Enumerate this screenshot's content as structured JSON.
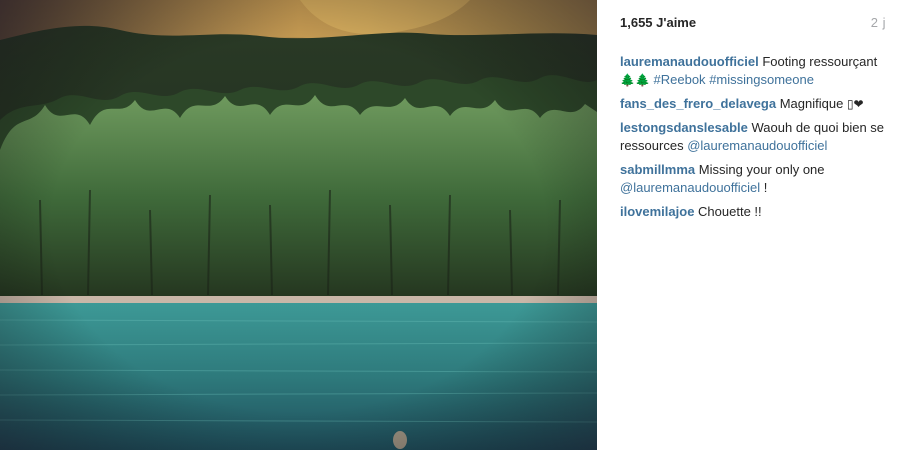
{
  "post": {
    "likes": "1,655 J'aime",
    "age": "2 j"
  },
  "photo": {
    "alt_icon": "landscape-photo"
  },
  "comments": [
    {
      "user": "lauremanaudouofficiel",
      "text": "Footing ressourçant",
      "line2_emoji": "🌲🌲",
      "tags": [
        "#Reebok",
        "#missingsomeone"
      ]
    },
    {
      "user": "fans_des_frero_delavega",
      "text": "Magnifique",
      "emoji": "▯❤"
    },
    {
      "user": "lestongsdanslesable",
      "text": "Waouh de quoi bien se ressources",
      "mention": "@lauremanaudouofficiel"
    },
    {
      "user": "sabmillmma",
      "text": "Missing your only one",
      "mention": "@lauremanaudouofficiel",
      "suffix": "!"
    },
    {
      "user": "ilovemilajoe",
      "text": "Chouette !!"
    }
  ],
  "colors": {
    "link": "#3f729b",
    "timestamp": "#a5a7aa"
  }
}
